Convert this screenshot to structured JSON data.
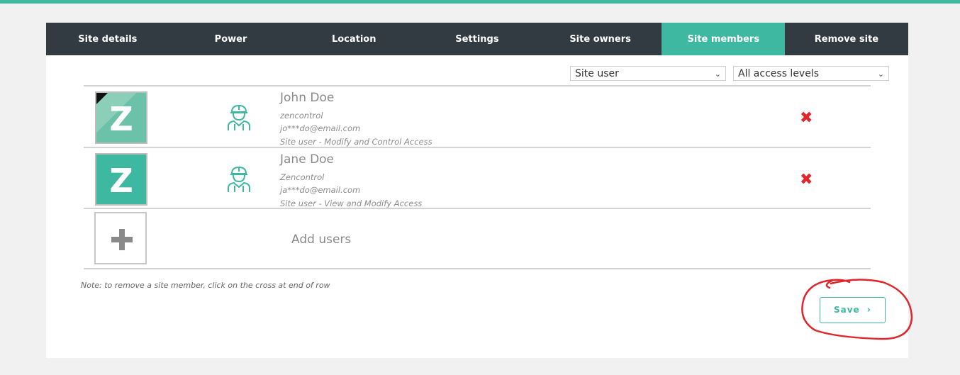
{
  "tabs": [
    {
      "label": "Site details",
      "active": false
    },
    {
      "label": "Power",
      "active": false
    },
    {
      "label": "Location",
      "active": false
    },
    {
      "label": "Settings",
      "active": false
    },
    {
      "label": "Site owners",
      "active": false
    },
    {
      "label": "Site members",
      "active": true
    },
    {
      "label": "Remove site",
      "active": false
    }
  ],
  "filters": {
    "role": {
      "value": "Site user"
    },
    "access": {
      "value": "All access levels"
    }
  },
  "members": [
    {
      "name": "John Doe",
      "company": "zencontrol",
      "email": "jo***do@email.com",
      "access": "Site user - Modify and Control Access",
      "avatar_letter": "Z",
      "avatar_color": "#6cc2a8",
      "icon": "worker-icon",
      "remove_icon": "cross-icon"
    },
    {
      "name": "Jane Doe",
      "company": "Zencontrol",
      "email": "ja***do@email.com",
      "access": "Site user - View and Modify Access",
      "avatar_letter": "Z",
      "avatar_color": "#3fb8a1",
      "icon": "worker-icon",
      "remove_icon": "cross-icon"
    }
  ],
  "add_users": {
    "label": "Add users",
    "icon": "plus-icon"
  },
  "note": "Note: to remove a site member, click on the cross at end of row",
  "save": {
    "label": "Save",
    "arrow": "›"
  },
  "colors": {
    "accent": "#3fb8a1",
    "tabbar": "#323a42",
    "danger": "#e0262b",
    "annotation": "#e0262b"
  }
}
